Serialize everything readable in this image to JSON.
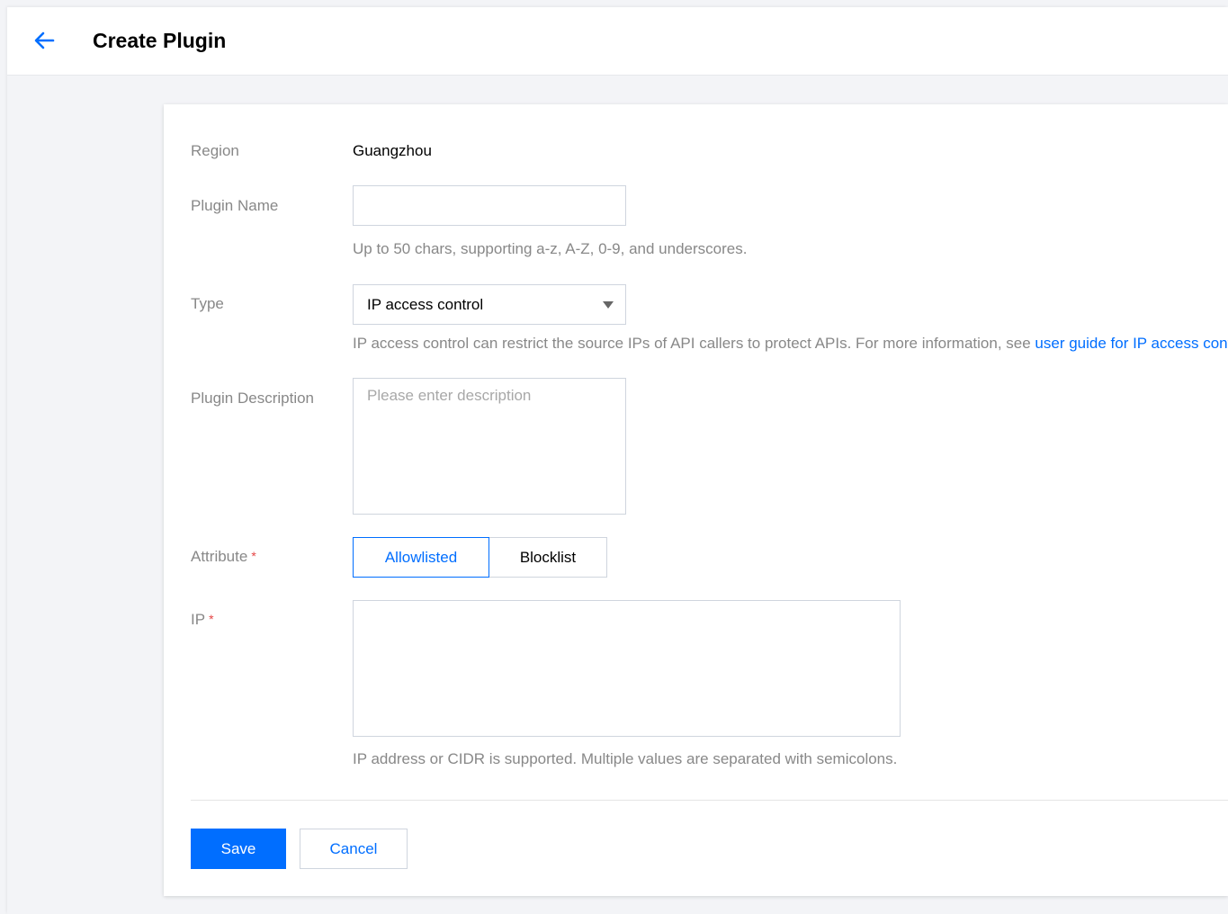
{
  "header": {
    "back_icon": "arrow-left-icon",
    "title": "Create Plugin"
  },
  "colors": {
    "accent": "#006eff",
    "required": "#e54545",
    "label": "#888888"
  },
  "form": {
    "region": {
      "label": "Region",
      "value": "Guangzhou"
    },
    "plugin_name": {
      "label": "Plugin Name",
      "value": "",
      "hint": "Up to 50 chars, supporting a-z, A-Z, 0-9, and underscores."
    },
    "type": {
      "label": "Type",
      "selected": "IP access control",
      "hint_prefix": "IP access control can restrict the source IPs of API callers to protect APIs. For more information, see ",
      "hint_link": "user guide for IP access control"
    },
    "description": {
      "label": "Plugin Description",
      "placeholder": "Please enter description",
      "value": ""
    },
    "attribute": {
      "label": "Attribute",
      "required_mark": "*",
      "options": [
        "Allowlisted",
        "Blocklist"
      ],
      "selected": "Allowlisted"
    },
    "ip": {
      "label": "IP",
      "required_mark": "*",
      "value": "",
      "hint": "IP address or CIDR is supported. Multiple values are separated with semicolons."
    }
  },
  "actions": {
    "save_label": "Save",
    "cancel_label": "Cancel"
  }
}
